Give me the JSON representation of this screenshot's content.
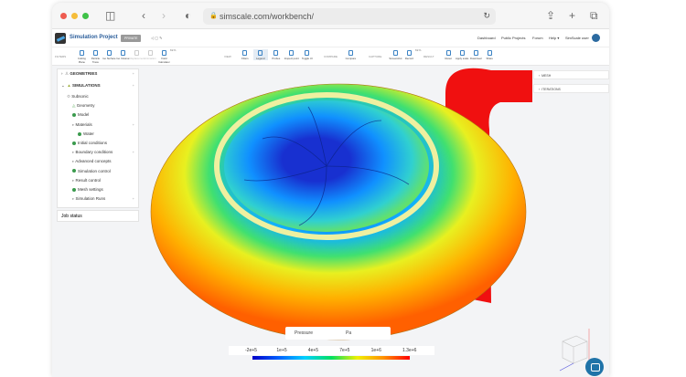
{
  "browser": {
    "url": "simscale.com/workbench/"
  },
  "header": {
    "project_title": "Simulation Project",
    "privacy_badge": "PRIVATE",
    "nav": [
      "Dashboard",
      "Public Projects",
      "Forum",
      "Help ▾",
      "SimScale user"
    ]
  },
  "toolbar": {
    "sections": [
      {
        "label": "FILTERS",
        "items": [
          {
            "label": "Cutting Plane"
          },
          {
            "label": "Particle Trace"
          },
          {
            "label": "Iso Surface"
          },
          {
            "label": "Iso Volume"
          },
          {
            "label": "Displacement",
            "disabled": true
          },
          {
            "label": "Animation",
            "disabled": true
          },
          {
            "label": "Field Calculator",
            "badge": "BETA"
          }
        ]
      },
      {
        "label": "VIEW",
        "items": [
          {
            "label": "Filters"
          },
          {
            "label": "Legend",
            "active": true
          },
          {
            "label": "Probes"
          },
          {
            "label": "Inspect point"
          },
          {
            "label": "Toggle UI"
          }
        ]
      },
      {
        "label": "COMPARE",
        "items": [
          {
            "label": "Compare"
          }
        ]
      },
      {
        "label": "CAPTURE",
        "items": [
          {
            "label": "Screenshot"
          },
          {
            "label": "Record",
            "badge": "BETA"
          }
        ]
      },
      {
        "label": "RESULT",
        "items": [
          {
            "label": "Reset"
          },
          {
            "label": "Apply scale"
          },
          {
            "label": "Download"
          },
          {
            "label": "Share"
          }
        ]
      }
    ]
  },
  "tree": {
    "geometries": "GEOMETRIES",
    "simulations": "SIMULATIONS",
    "items": [
      {
        "label": "Subsonic",
        "level": 1,
        "icon": "simulation-icon"
      },
      {
        "label": "Geometry",
        "level": 2,
        "icon": "geometry-icon"
      },
      {
        "label": "Model",
        "level": 2,
        "icon": "check-dot"
      },
      {
        "label": "Materials",
        "level": 2,
        "icon": "expand",
        "plus": true
      },
      {
        "label": "Water",
        "level": 3,
        "icon": "check-dot"
      },
      {
        "label": "Initial conditions",
        "level": 2,
        "icon": "check-dot"
      },
      {
        "label": "Boundary conditions",
        "level": 2,
        "icon": "expand",
        "plus": true
      },
      {
        "label": "Advanced concepts",
        "level": 2,
        "icon": "expand"
      },
      {
        "label": "Simulation control",
        "level": 2,
        "icon": "check-dot"
      },
      {
        "label": "Result control",
        "level": 2,
        "icon": "expand"
      },
      {
        "label": "Mesh settings",
        "level": 2,
        "icon": "check-dot"
      },
      {
        "label": "Simulation Runs",
        "level": 2,
        "icon": "expand",
        "plus": true
      }
    ]
  },
  "job_status": "Job status",
  "right_panels": [
    "MESH",
    "ITERATIONS"
  ],
  "legend": {
    "field": "Pressure",
    "unit": "Pa",
    "ticks": [
      "-2e+5",
      "1e+5",
      "4e+5",
      "7e+5",
      "1e+6",
      "1.3e+6"
    ],
    "colormap": [
      "#0000c8",
      "#0060ff",
      "#00d0ff",
      "#00e060",
      "#f0f000",
      "#ff9000",
      "#ff0000"
    ]
  }
}
